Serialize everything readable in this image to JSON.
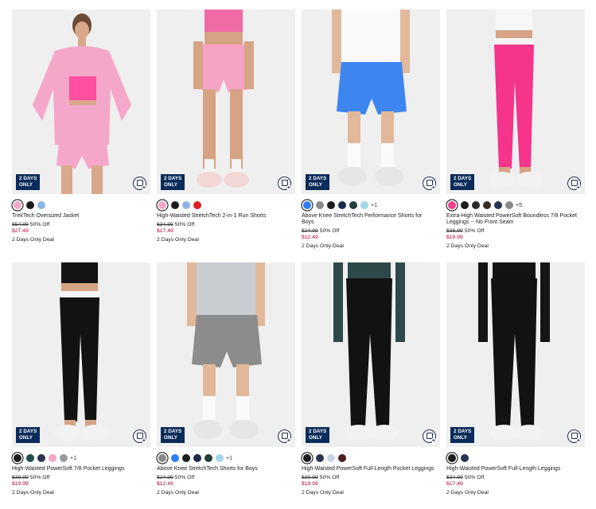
{
  "products": [
    {
      "name": "TrekTech Oversized Jacket",
      "badge": [
        "2 DAYS",
        "ONLY"
      ],
      "original_price": "$54.99",
      "discount": "50% Off",
      "sale_price": "$27.49",
      "deal_label": "2 Days Only Deal",
      "more_colors": "",
      "swatches": [
        "#f0a6c8",
        "#1c1c1c",
        "#8fb3e8"
      ],
      "selected_swatch": 0,
      "photo": {
        "bg": "#efefef",
        "skin": "#d9a88a",
        "top": "#f5a7c9",
        "bottom": "#f5a7c9",
        "shoes": "#e8e8e8",
        "accent": "#ff4fa0",
        "type": "jacket"
      }
    },
    {
      "name": "High-Waisted StretchTech 2-in-1 Run Shorts",
      "badge": [
        "2 DAYS",
        "ONLY"
      ],
      "original_price": "$34.99",
      "discount": "50% Off",
      "sale_price": "$17.49",
      "deal_label": "2 Days Only Deal",
      "more_colors": "",
      "swatches": [
        "#f0a6c8",
        "#1c1c1c",
        "#8fb3e8",
        "#e02020"
      ],
      "selected_swatch": 0,
      "photo": {
        "bg": "#efefef",
        "skin": "#d7a385",
        "top": "#f06aa6",
        "bottom": "#f7a3c6",
        "shoes": "#f2d7d7",
        "accent": "#f4f4f4",
        "type": "shorts"
      }
    },
    {
      "name": "Above Knee StretchTech Performance Shorts for Boys",
      "badge": [
        "2 DAYS",
        "ONLY"
      ],
      "original_price": "$24.99",
      "discount": "50% Off",
      "sale_price": "$12.49",
      "deal_label": "2 Days Only Deal",
      "more_colors": "+1",
      "swatches": [
        "#2f7cf6",
        "#8a8a8a",
        "#1c1c1c",
        "#1e2a4a",
        "#233d3b",
        "#9fd9e8"
      ],
      "selected_swatch": 0,
      "photo": {
        "bg": "#efefef",
        "skin": "#e2b89b",
        "top": "#fafafa",
        "bottom": "#3d86f0",
        "shoes": "#e6e6e6",
        "accent": "#ffffff",
        "type": "boyshorts"
      }
    },
    {
      "name": "Extra-High Waisted PowerSoft Boundless 7/8 Pocket Leggings -- No Front Seam",
      "badge": [
        "2 DAYS",
        "ONLY"
      ],
      "original_price": "$38.99",
      "discount": "50% Off",
      "sale_price": "$19.99",
      "deal_label": "2 Days Only Deal",
      "more_colors": "+5",
      "swatches": [
        "#f0408a",
        "#1c1c1c",
        "#2a2a2a",
        "#3a2a22",
        "#2b3552",
        "#8a8a8a"
      ],
      "selected_swatch": 0,
      "photo": {
        "bg": "#efefef",
        "skin": "#d7a385",
        "top": "#f7f7f7",
        "bottom": "#f5348a",
        "shoes": "#f2f2f2",
        "accent": "#f7f7f7",
        "type": "leggings"
      }
    },
    {
      "name": "High-Waisted PowerSoft 7/8 Pocket Leggings",
      "badge": [
        "2 DAYS",
        "ONLY"
      ],
      "original_price": "$39.99",
      "discount": "50% Off",
      "sale_price": "$19.99",
      "deal_label": "2 Days Only Deal",
      "more_colors": "+1",
      "swatches": [
        "#1c1c1c",
        "#1f4f4a",
        "#2b3552",
        "#f3a6c4",
        "#9a9a9a"
      ],
      "selected_swatch": 0,
      "photo": {
        "bg": "#efefef",
        "skin": "#d7a385",
        "top": "#141414",
        "bottom": "#121212",
        "shoes": "#f2f2f2",
        "accent": "#141414",
        "type": "leggings"
      }
    },
    {
      "name": "Above Knee StretchTech Shorts for Boys",
      "badge": [
        "2 DAYS",
        "ONLY"
      ],
      "original_price": "$24.99",
      "discount": "50% Off",
      "sale_price": "$12.49",
      "deal_label": "2 Days Only Deal",
      "more_colors": "+1",
      "swatches": [
        "#8a8a8a",
        "#2f7cf6",
        "#1c1c1c",
        "#1e2a4a",
        "#233d3b",
        "#9fd9e8"
      ],
      "selected_swatch": 0,
      "photo": {
        "bg": "#efefef",
        "skin": "#e2b89b",
        "top": "#c9cdd2",
        "bottom": "#8c8c8c",
        "shoes": "#e6e6e6",
        "accent": "#c9cdd2",
        "type": "boyshorts"
      }
    },
    {
      "name": "High-Waisted PowerSoft Full-Length Pocket Leggings",
      "badge": [
        "2 DAYS",
        "ONLY"
      ],
      "original_price": "$39.99",
      "discount": "50% Off",
      "sale_price": "$19.99",
      "deal_label": "2 Days Only Deal",
      "more_colors": "",
      "swatches": [
        "#1c1c1c",
        "#2b3552",
        "#c9d3ea",
        "#4a1f1f"
      ],
      "selected_swatch": 0,
      "photo": {
        "bg": "#efefef",
        "skin": "#d7a385",
        "top": "#2c4848",
        "bottom": "#121212",
        "shoes": "#f2f2f2",
        "accent": "#2c4848",
        "type": "longleggings"
      }
    },
    {
      "name": "High-Waisted PowerSoft Full-Length Leggings",
      "badge": [
        "2 DAYS",
        "ONLY"
      ],
      "original_price": "$34.99",
      "discount": "50% Off",
      "sale_price": "$17.49",
      "deal_label": "2 Days Only Deal",
      "more_colors": "",
      "swatches": [
        "#1c1c1c",
        "#2b3552"
      ],
      "selected_swatch": 0,
      "photo": {
        "bg": "#efefef",
        "skin": "#d7a385",
        "top": "#141414",
        "bottom": "#121212",
        "shoes": "#f2f2f2",
        "accent": "#141414",
        "type": "longleggings"
      }
    }
  ],
  "colors": {
    "badge_bg": "#0b2c5a",
    "sale_price": "#b3002d"
  },
  "icons": {
    "quick_add": "bag-plus-icon",
    "badge": "deal-badge"
  }
}
